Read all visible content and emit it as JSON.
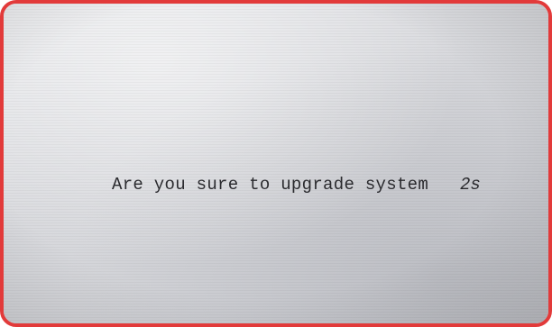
{
  "dialog": {
    "message": "Are you sure to upgrade system",
    "countdown": "2s"
  },
  "colors": {
    "frame_border": "#e23a3a",
    "screen_background": "#dcdde0",
    "text": "#2a2a2e"
  }
}
